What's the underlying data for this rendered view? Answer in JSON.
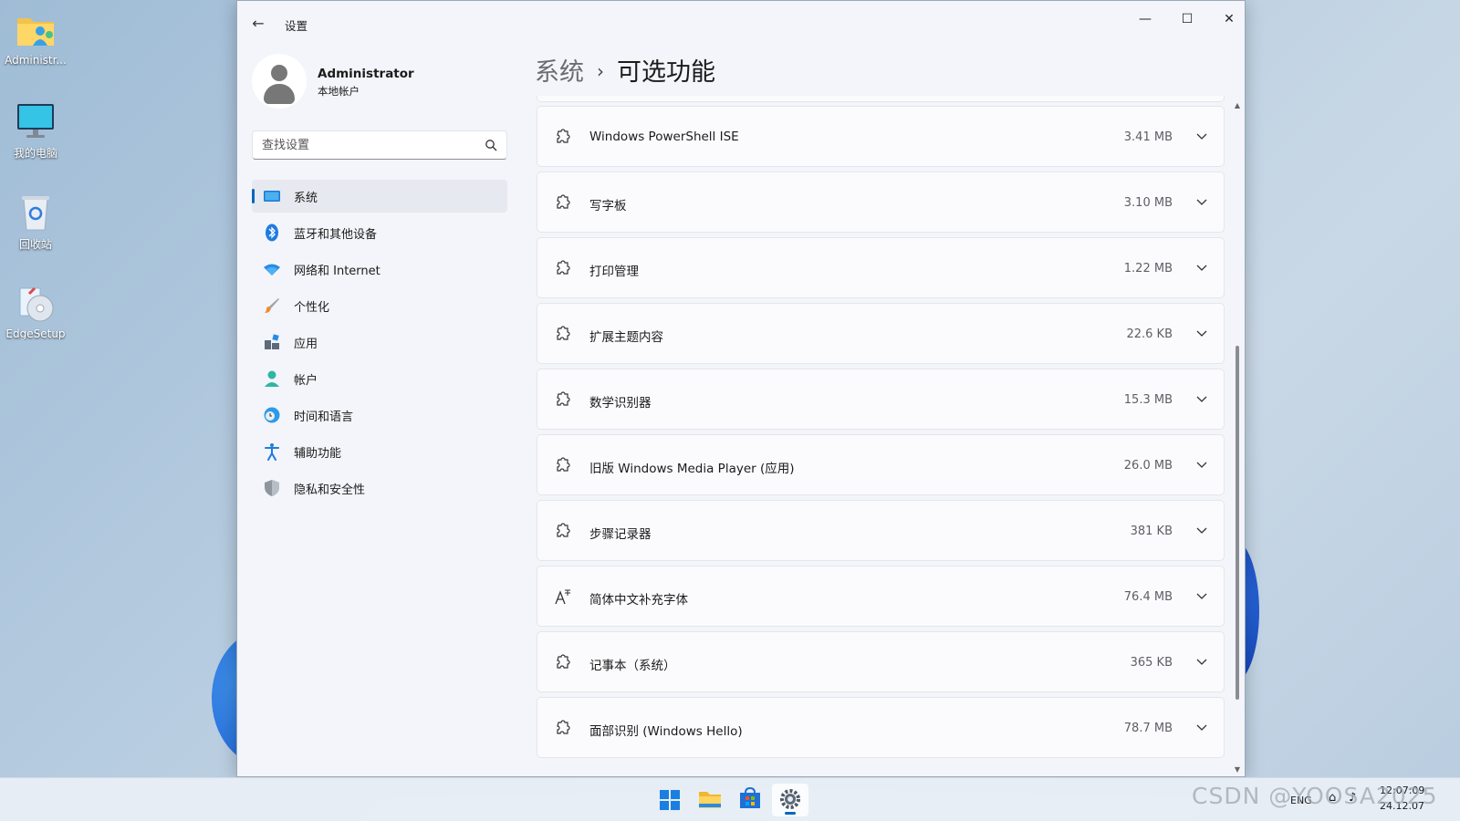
{
  "desktop": {
    "icons": [
      {
        "label": "Administr..."
      },
      {
        "label": "我的电脑"
      },
      {
        "label": "回收站"
      },
      {
        "label": "EdgeSetup"
      }
    ]
  },
  "window": {
    "title": "设置",
    "controls": {
      "minimize": "—",
      "maximize": "☐",
      "close": "✕"
    }
  },
  "profile": {
    "name": "Administrator",
    "account_type": "本地帐户"
  },
  "search": {
    "placeholder": "查找设置"
  },
  "sidebar": {
    "items": [
      {
        "label": "系统",
        "icon": "system-icon",
        "active": true
      },
      {
        "label": "蓝牙和其他设备",
        "icon": "bluetooth-icon"
      },
      {
        "label": "网络和 Internet",
        "icon": "wifi-icon"
      },
      {
        "label": "个性化",
        "icon": "brush-icon"
      },
      {
        "label": "应用",
        "icon": "apps-icon"
      },
      {
        "label": "帐户",
        "icon": "account-icon"
      },
      {
        "label": "时间和语言",
        "icon": "globe-clock-icon"
      },
      {
        "label": "辅助功能",
        "icon": "accessibility-icon"
      },
      {
        "label": "隐私和安全性",
        "icon": "shield-icon"
      }
    ]
  },
  "breadcrumb": {
    "parent": "系统",
    "separator": "›",
    "current": "可选功能"
  },
  "features": [
    {
      "name": "Windows PowerShell ISE",
      "size": "3.41 MB",
      "icon": "puzzle-icon"
    },
    {
      "name": "写字板",
      "size": "3.10 MB",
      "icon": "puzzle-icon"
    },
    {
      "name": "打印管理",
      "size": "1.22 MB",
      "icon": "puzzle-icon"
    },
    {
      "name": "扩展主题内容",
      "size": "22.6 KB",
      "icon": "puzzle-icon"
    },
    {
      "name": "数学识别器",
      "size": "15.3 MB",
      "icon": "puzzle-icon"
    },
    {
      "name": "旧版 Windows Media Player (应用)",
      "size": "26.0 MB",
      "icon": "puzzle-icon"
    },
    {
      "name": "步骤记录器",
      "size": "381 KB",
      "icon": "puzzle-icon"
    },
    {
      "name": "简体中文补充字体",
      "size": "76.4 MB",
      "icon": "font-icon"
    },
    {
      "name": "记事本（系统）",
      "size": "365 KB",
      "icon": "puzzle-icon"
    },
    {
      "name": "面部识别 (Windows Hello)",
      "size": "78.7 MB",
      "icon": "puzzle-icon"
    }
  ],
  "taskbar": {
    "apps": [
      "start-icon",
      "file-explorer-icon",
      "store-icon",
      "settings-icon"
    ],
    "tray": {
      "language": "ENG",
      "time": "12:07:09",
      "date": "24.12.07"
    }
  },
  "watermark": "CSDN @YOOSA2025",
  "colors": {
    "accent": "#0067c0",
    "window_bg": "#f3f5fa",
    "card_bg": "#fbfbfd"
  }
}
